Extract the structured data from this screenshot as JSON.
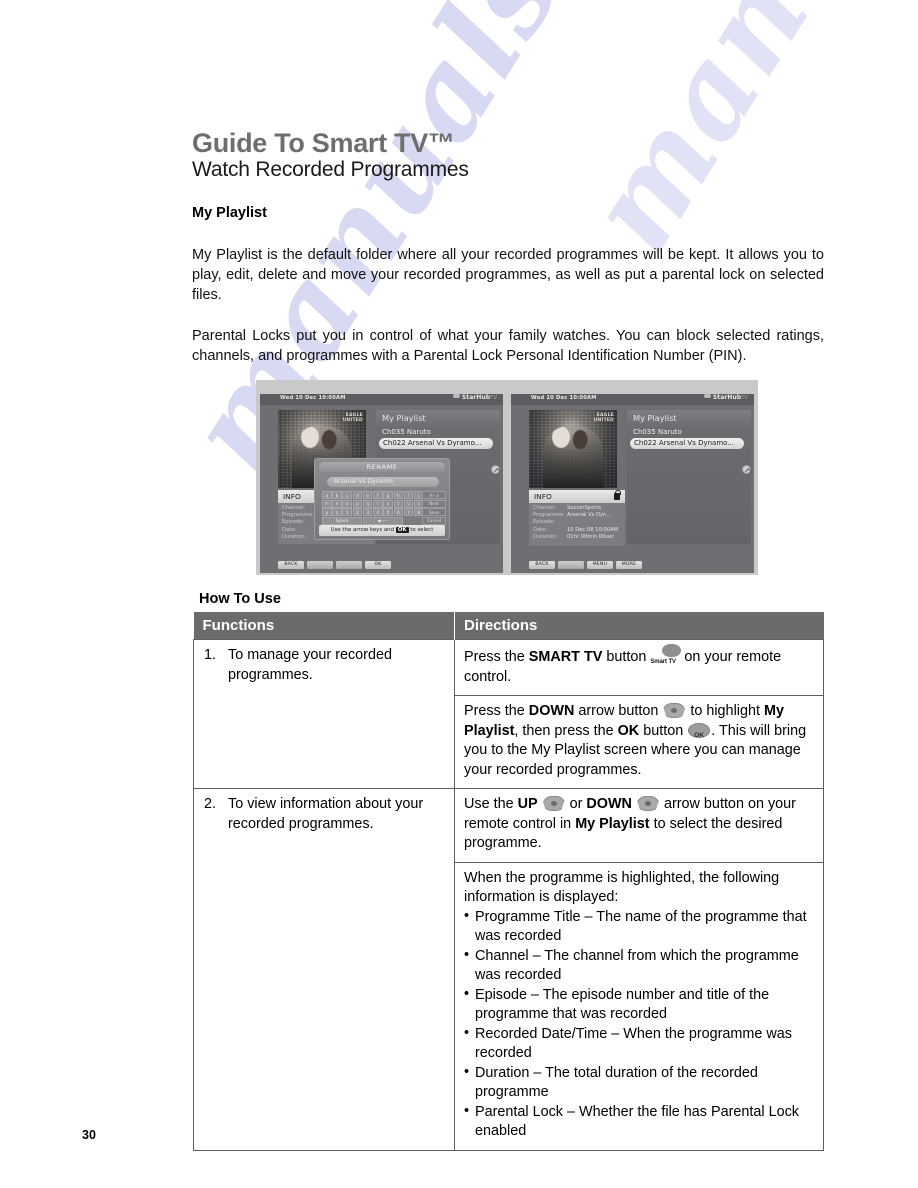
{
  "document": {
    "title": "Guide To Smart TV™",
    "subtitle": "Watch Recorded Programmes",
    "section_heading": "My Playlist",
    "page_number": "30",
    "watermark": "manualsh"
  },
  "paragraphs": {
    "p1": "My Playlist is the default folder where all your recorded programmes will be kept. It allows you to play, edit, delete and move your recorded programmes, as well as put a parental lock on selected files.",
    "p2": "Parental Locks put you in control of what your family watches. You can block selected ratings, channels, and programmes with a Parental Lock Personal Identification Number (PIN)."
  },
  "screenshots": {
    "left": {
      "clock": "Wed 10 Dec 10:00AM",
      "brand": "StarHub",
      "brand_suffix": "TV",
      "thumb_logo_line1": "EAGLE",
      "thumb_logo_line2": "UNITED",
      "playlist_title": "My Playlist",
      "item_1": "Ch035 Naruto",
      "item_2": "Ch022 Arsenal Vs Dyramo...",
      "dialog_title": "RENAME",
      "dialog_input": "Arsenal Vs Dynamo_",
      "keys_row1": [
        "a",
        "b",
        "c",
        "d",
        "e",
        "f",
        "g",
        "h",
        "i",
        "j",
        "k"
      ],
      "keys_row2": [
        "l",
        "m",
        "n",
        "o",
        "p",
        "q",
        "r",
        "s",
        "t",
        "u",
        "v"
      ],
      "keys_row3": [
        "w",
        "x",
        "y",
        "z",
        "1",
        "2",
        "3",
        "4",
        "5",
        "6",
        "7"
      ],
      "keys_row4": [
        "8",
        "9",
        "0"
      ],
      "key_space": "Space",
      "side_keys": [
        "A» a",
        "Next",
        "Save",
        "Cancel"
      ],
      "hint_pre": "Use the arrow keys and ",
      "hint_key": "OK",
      "hint_post": " to select",
      "info_title": "INFO",
      "info_labels": [
        "Channel:",
        "Programme:",
        "Episode:",
        "Date:",
        "Duration:"
      ],
      "buttons": [
        "BACK",
        "",
        "OK"
      ]
    },
    "right": {
      "clock": "Wed 10 Dec 10:00AM",
      "brand": "StarHub",
      "brand_suffix": "TV",
      "thumb_logo_line1": "EAGLE",
      "thumb_logo_line2": "UNITED",
      "playlist_title": "My Playlist",
      "item_1": "Ch035 Naruto",
      "item_2": "Ch022 Arsenal Vs Dynamo...",
      "info_title": "INFO",
      "info_rows": [
        {
          "label": "Channel:",
          "value": "SoccerSports"
        },
        {
          "label": "Programme:",
          "value": "Arsenal Vs Dyn..."
        },
        {
          "label": "Episode:",
          "value": ""
        },
        {
          "label": "Date:",
          "value": "10 Dec 08 10:00AM"
        },
        {
          "label": "Duration:",
          "value": "01hr 00min 00sec"
        }
      ],
      "buttons": [
        "BACK",
        "",
        "MENU",
        "MORE"
      ]
    }
  },
  "how_to_use": {
    "heading": "How To Use",
    "columns": [
      "Functions",
      "Directions"
    ],
    "rows": [
      {
        "number": "1.",
        "function": "To manage your recorded programmes.",
        "directions": [
          {
            "parts": [
              {
                "t": "text",
                "v": "Press the "
              },
              {
                "t": "bold",
                "v": "SMART TV"
              },
              {
                "t": "text",
                "v": " button "
              },
              {
                "t": "icon",
                "v": "smart-tv-button-icon",
                "label": "Smart TV"
              },
              {
                "t": "text",
                "v": "on your remote control."
              }
            ]
          },
          {
            "parts": [
              {
                "t": "text",
                "v": "Press the "
              },
              {
                "t": "bold",
                "v": "DOWN"
              },
              {
                "t": "text",
                "v": " arrow button "
              },
              {
                "t": "icon",
                "v": "down-arrow-button-icon"
              },
              {
                "t": "text",
                "v": " to highlight "
              },
              {
                "t": "bold",
                "v": "My Playlist"
              },
              {
                "t": "text",
                "v": ", then press the "
              },
              {
                "t": "bold",
                "v": "OK"
              },
              {
                "t": "text",
                "v": " button "
              },
              {
                "t": "icon",
                "v": "ok-button-icon",
                "label": "OK"
              },
              {
                "t": "text",
                "v": ". This will bring you to the My Playlist screen where you can manage your recorded programmes."
              }
            ]
          }
        ]
      },
      {
        "number": "2.",
        "function": "To view information about your recorded programmes.",
        "directions": [
          {
            "parts": [
              {
                "t": "text",
                "v": "Use the "
              },
              {
                "t": "bold",
                "v": "UP"
              },
              {
                "t": "text",
                "v": " "
              },
              {
                "t": "icon",
                "v": "up-arrow-button-icon"
              },
              {
                "t": "text",
                "v": " or "
              },
              {
                "t": "bold",
                "v": "DOWN"
              },
              {
                "t": "text",
                "v": " "
              },
              {
                "t": "icon",
                "v": "down-arrow-button-icon"
              },
              {
                "t": "text",
                "v": " arrow button on your remote control in "
              },
              {
                "t": "bold",
                "v": "My Playlist"
              },
              {
                "t": "text",
                "v": " to select the desired programme."
              }
            ]
          },
          {
            "intro": "When the programme is highlighted, the following information is displayed:",
            "bullets": [
              "Programme Title – The name of the programme that was recorded",
              "Channel – The channel from which the programme was recorded",
              "Episode – The episode number and title of the programme that was recorded",
              "Recorded Date/Time – When the programme was recorded",
              "Duration – The total duration of the recorded programme",
              "Parental Lock – Whether the file has Parental Lock enabled"
            ]
          }
        ]
      }
    ]
  },
  "colors": {
    "title_gray": "#6e6e6e",
    "table_header_bg": "#6b6b6b",
    "table_border": "#5f5f5f",
    "watermark": "#b9bbe8",
    "screen_bg": "#6d6f72"
  }
}
